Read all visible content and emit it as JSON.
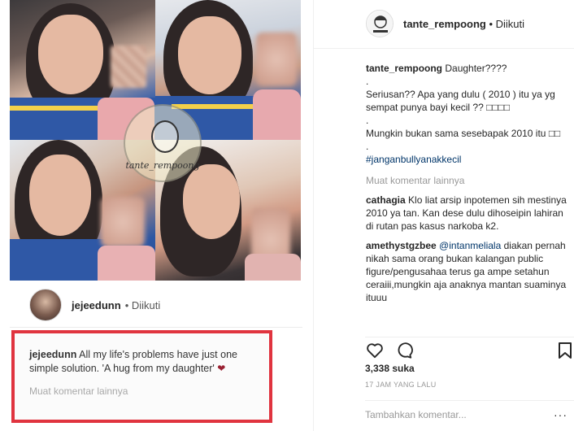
{
  "embedded_post": {
    "watermark_text": "tante_rempoong",
    "author": {
      "username": "jejeedunn",
      "follow_status": "• Diikuti"
    },
    "caption": {
      "username": "jejeedunn",
      "text": "All my life's problems have just one simple solution. 'A hug from my daughter'",
      "heart": "❤"
    },
    "more_comments": "Muat komentar lainnya"
  },
  "post": {
    "author": {
      "username": "tante_rempoong",
      "follow_status": "• Diikuti"
    },
    "caption": {
      "username": "tante_rempoong",
      "lines": [
        "Daughter????",
        ".",
        "Seriusan?? Apa yang dulu ( 2010 ) itu ya yg sempat punya bayi kecil ?? □□□□",
        ".",
        "Mungkin bukan sama sesebapak 2010 itu □□",
        "."
      ],
      "hashtag": "#janganbullyanakkecil"
    },
    "more_comments": "Muat komentar lainnya",
    "comments": [
      {
        "username": "cathagia",
        "mention": "",
        "text": "Klo liat arsip inpotemen sih mestinya 2010 ya tan. Kan dese dulu dihoseipin lahiran di rutan pas kasus narkoba k2."
      },
      {
        "username": "amethystgzbee",
        "mention": "@intanmeliala",
        "text": "diakan pernah nikah sama orang bukan kalangan public figure/pengusahaa terus ga ampe setahun ceraiii,mungkin aja anaknya mantan suaminya ituuu"
      }
    ],
    "likes": "3,338 suka",
    "timestamp": "17 JAM YANG LALU",
    "add_comment_placeholder": "Tambahkan komentar...",
    "more_options": "···"
  },
  "icons": [
    "heart-icon",
    "comment-icon",
    "bookmark-icon"
  ],
  "colors": {
    "highlight_box": "#e0343f",
    "link": "#003569",
    "muted": "#999999"
  }
}
